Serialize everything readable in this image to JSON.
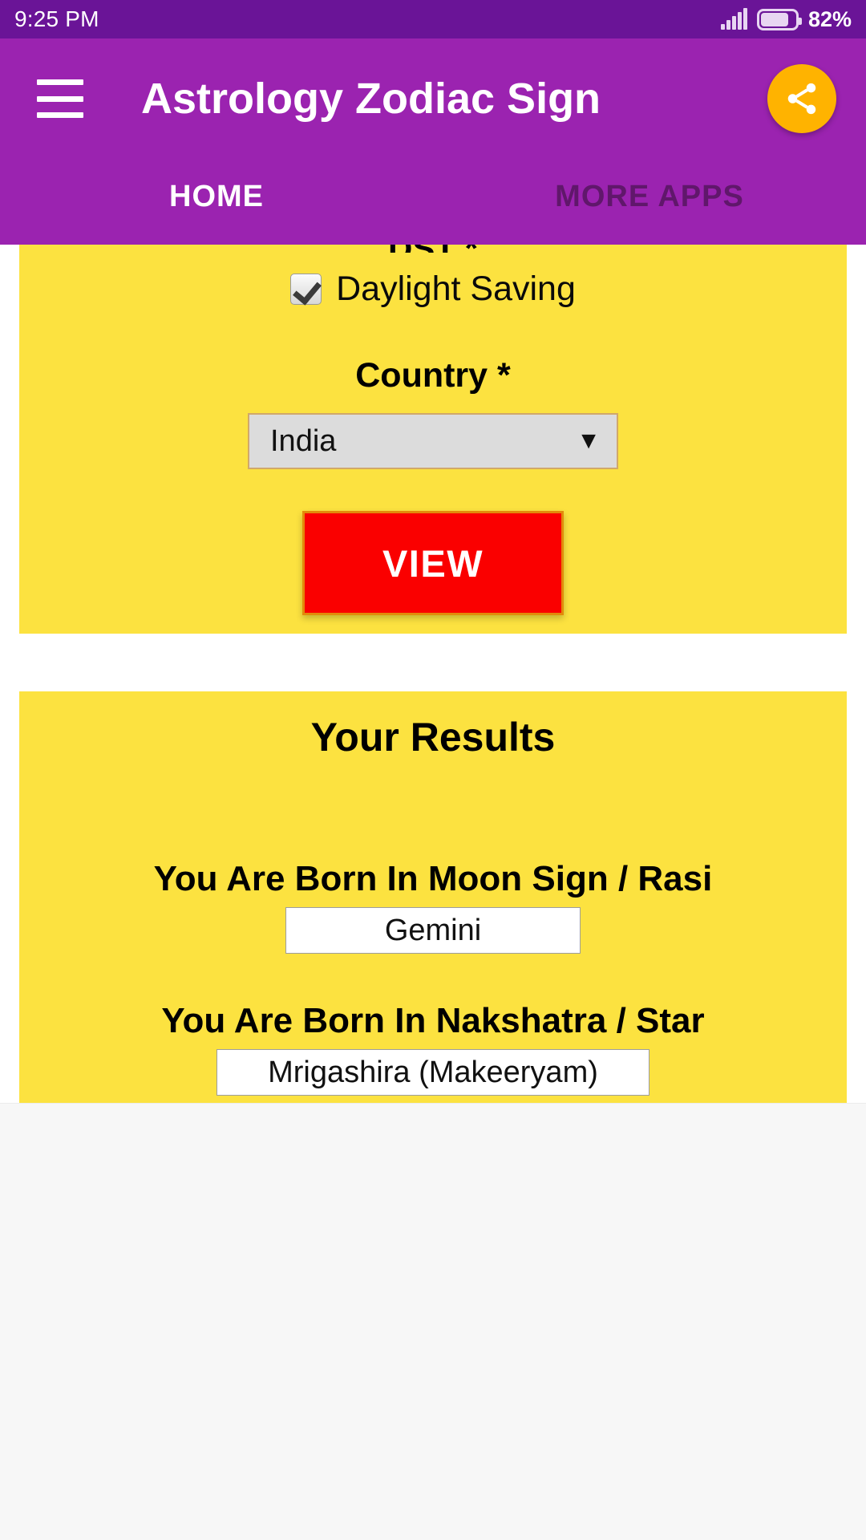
{
  "status_bar": {
    "time": "9:25 PM",
    "battery_percent": "82%",
    "signal_icon": "signal-bars-icon",
    "battery_icon": "battery-icon"
  },
  "app_bar": {
    "menu_icon": "hamburger-menu-icon",
    "title": "Astrology Zodiac Sign",
    "share_icon": "share-icon",
    "accent_color": "#9B23B0",
    "status_color": "#6A1497",
    "fab_color": "#FFB300"
  },
  "tabs": [
    {
      "label": "HOME",
      "active": true
    },
    {
      "label": "MORE APPS",
      "active": false
    }
  ],
  "form_card": {
    "background_color": "#FCE240",
    "dst_label": "DST *",
    "daylight_saving": {
      "label": "Daylight Saving",
      "checked": true
    },
    "country": {
      "label": "Country *",
      "selected": "India",
      "caret_icon": "chevron-down-icon"
    },
    "view_button": {
      "label": "VIEW",
      "color": "#FA0000",
      "border_color": "#E38A0A",
      "text_color": "#FFFFFF"
    }
  },
  "results_card": {
    "background_color": "#FCE240",
    "title": "Your Results",
    "rows": [
      {
        "label": "You Are Born In Moon Sign / Rasi",
        "value": "Gemini"
      },
      {
        "label": "You Are Born In Nakshatra / Star",
        "value": "Mrigashira (Makeeryam)"
      }
    ]
  }
}
